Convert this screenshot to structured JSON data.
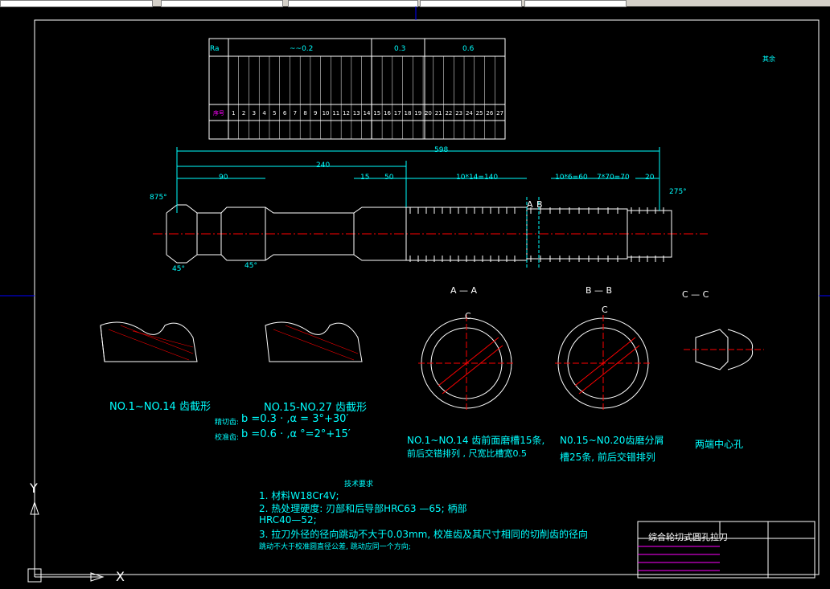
{
  "table": {
    "top": [
      "Ra",
      "~~0.2",
      "0.3",
      "0.6"
    ],
    "col_headers": [
      "序号",
      "1",
      "2",
      "3",
      "4",
      "5",
      "6",
      "7",
      "8",
      "9",
      "10",
      "11",
      "12",
      "13",
      "14",
      "15",
      "16",
      "17",
      "18",
      "19",
      "20",
      "21",
      "22",
      "23",
      "24",
      "25",
      "26",
      "27"
    ]
  },
  "dims": {
    "total": "598",
    "d240": "240",
    "d90": "90",
    "d15": "15",
    "d50": "50",
    "d10x14": "10*14=140",
    "d10x6": "10*6=60",
    "d7x70": "7*70=70",
    "d20": "20",
    "a275": "275°",
    "a875": "875°",
    "a45a": "45°",
    "a45b": "45°"
  },
  "sections": {
    "aa": "A — A",
    "bb": "B — B",
    "cc": "C — C",
    "c1": "C",
    "c2": "C",
    "a_mark": "A",
    "b_mark": "B"
  },
  "labels": {
    "profile1": "NO.1~NO.14 齿截形",
    "profile2": "NO.15-NO.27 齿截形",
    "param1_label": "精切齿:",
    "param1": "b =0.3 ·  ,α = 3°+30′",
    "param2_label": "校准齿:",
    "param2": "b =0.6 ·  ,α °=2°+15′",
    "aa_note1": "NO.1~NO.14 齿前面磨槽15条,",
    "aa_note2": "前后交错排列 , 尺宽比槽宽0.5",
    "bb_note1": "N0.15~N0.20齿磨分屑",
    "bb_note2": "槽25条, 前后交错排列",
    "cc_note": "两端中心孔",
    "tech_title": "技术要求",
    "tech1": "1. 材料W18Cr4V;",
    "tech2": "2. 热处理硬度: 刃部和后导部HRC63 —65; 柄部",
    "tech2b": "HRC40—52;",
    "tech3": "3. 拉刀外径的径向跳动不大于0.03mm, 校准齿及其尺寸相同的切削齿的径向",
    "tech3b": "跳动不大于校准圆直径公差, 跳动应同一个方向;",
    "rough": "其余",
    "title_block": "综合轮切式圆孔拉刀"
  },
  "axes": {
    "y": "Y",
    "x": "X"
  }
}
